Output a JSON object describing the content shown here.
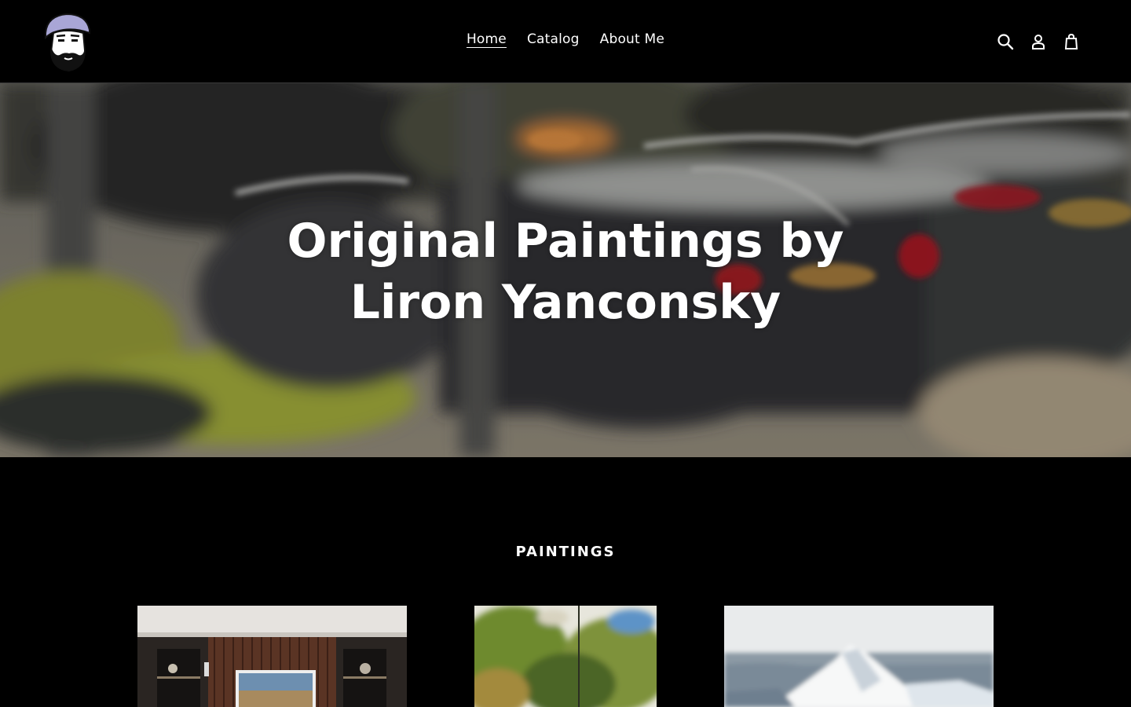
{
  "header": {
    "logo_name": "bearded-man-cap-logo",
    "nav": [
      {
        "label": "Home",
        "active": true
      },
      {
        "label": "Catalog",
        "active": false
      },
      {
        "label": "About Me",
        "active": false
      }
    ],
    "icons": [
      "search-icon",
      "account-icon",
      "cart-icon"
    ]
  },
  "hero": {
    "title": "Original Paintings by Liron Yanconsky",
    "image": "watercolor-cars-painting"
  },
  "section": {
    "title": "PAINTINGS",
    "products": [
      {
        "image": "living-room-mockup-painting"
      },
      {
        "image": "green-trees-watercolor"
      },
      {
        "image": "snowy-mountain-watercolor"
      }
    ]
  },
  "colors": {
    "background": "#000000",
    "text": "#ffffff",
    "divider": "#3a3a3a"
  }
}
